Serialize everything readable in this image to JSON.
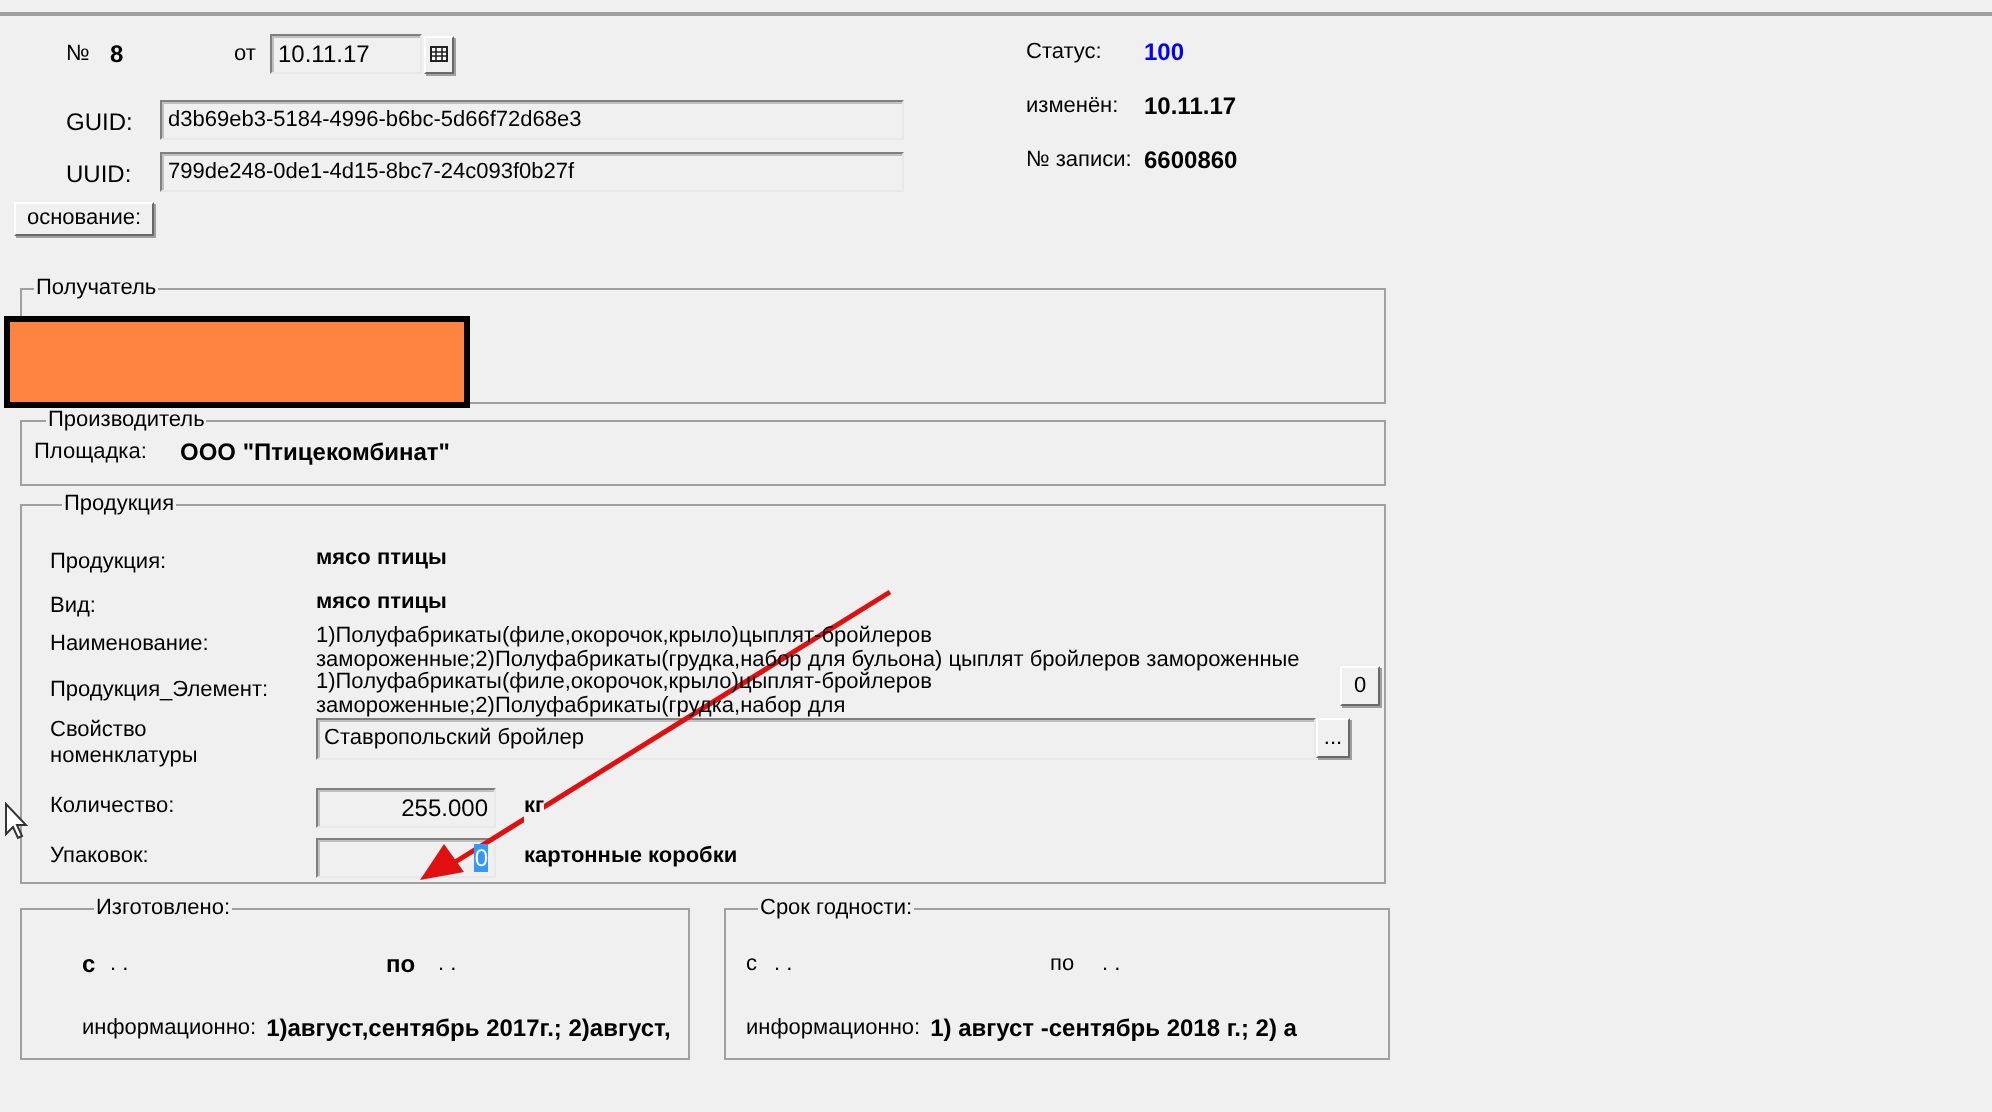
{
  "header": {
    "number_label": "№",
    "number": "8",
    "date_label": "от",
    "date": "10.11.17",
    "guid_label": "GUID:",
    "guid": "d3b69eb3-5184-4996-b6bc-5d66f72d68e3",
    "uuid_label": "UUID:",
    "uuid": "799de248-0de1-4d15-8bc7-24c093f0b27f",
    "basis_button": "основание:"
  },
  "status": {
    "status_label": "Статус:",
    "status": "100",
    "changed_label": "изменён:",
    "changed": "10.11.17",
    "record_label": "№ записи:",
    "record": "6600860"
  },
  "recipient": {
    "title": "Получатель"
  },
  "producer": {
    "title": "Производитель",
    "site_label": "Площадка:",
    "site": "ООО \"Птицекомбинат\""
  },
  "products": {
    "title": "Продукция",
    "rows": [
      {
        "kind": "text",
        "label": "Продукция:",
        "value": "мясо птицы"
      },
      {
        "kind": "text",
        "label": "Вид:",
        "value": "мясо птицы"
      },
      {
        "kind": "multiline",
        "label": "Наименование:",
        "lines": [
          "1)Полуфабрикаты(филе,окорочок,крыло)цыплят-бройлеров",
          "замороженные;2)Полуфабрикаты(грудка,набор для бульона) цыплят бройлеров замороженные"
        ]
      },
      {
        "kind": "multiline",
        "label": "Продукция_Элемент:",
        "lines": [
          "1)Полуфабрикаты(филе,окорочок,крыло)цыплят-бройлеров",
          "замороженные;2)Полуфабрикаты(грудка,набор для"
        ],
        "button": "0"
      },
      {
        "kind": "lookup",
        "label": "Свойство номенклатуры",
        "value": "Ставропольский бройлер",
        "button": "..."
      },
      {
        "kind": "quantity",
        "label": "Количество:",
        "value": "255.000",
        "unit": "кг",
        "highlighted": false
      },
      {
        "kind": "quantity",
        "label": "Упаковок:",
        "value": "0",
        "unit": "картонные коробки",
        "highlighted": true
      }
    ]
  },
  "periods": [
    {
      "title": "Изготовлено:",
      "bold_labels": true,
      "from_label": "с",
      "from": ". .",
      "to_label": "по",
      "to": ". .",
      "info_label": "информационно:",
      "info": "1)август,сентябрь 2017г.; 2)август,"
    },
    {
      "title": "Срок годности:",
      "bold_labels": false,
      "from_label": "с",
      "from": ". .",
      "to_label": "по",
      "to": ". .",
      "info_label": "информационно:",
      "info": "1) август -сентябрь 2018 г.; 2) а"
    }
  ]
}
